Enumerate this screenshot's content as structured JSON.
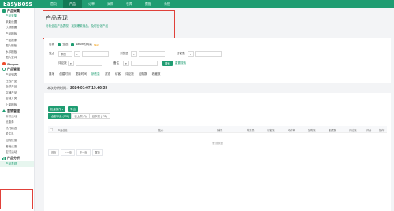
{
  "app": {
    "logo": "EasyBoss"
  },
  "topnav": [
    "首页",
    "产品",
    "订单",
    "采购",
    "仓库",
    "数据",
    "系统"
  ],
  "sidebar": {
    "sections": [
      {
        "label": "产品采集",
        "items": [
          "产品采集",
          "采集设置",
          "认领配置",
          "产品模板",
          "产品搬家",
          "图片模板",
          "水印模板",
          "图片空间"
        ]
      },
      {
        "label": "Shopee",
        "items": []
      },
      {
        "label": "产品管理",
        "items": [
          "产品列表",
          "在线产品",
          "全球产品",
          "店铺产品",
          "店铺分类",
          "上架模板"
        ]
      },
      {
        "label": "营销管理",
        "items": [
          "折扣活动",
          "优惠券",
          "热门精选",
          "关注礼",
          "加购优惠",
          "套装优惠",
          "定时活动"
        ]
      },
      {
        "label": "产品分析",
        "items": [
          "产品表现"
        ]
      }
    ]
  },
  "header": {
    "title": "产品表现",
    "desc": "分析全店产品表现，找到爆款商品，及时优化产品"
  },
  "filters": {
    "row1": {
      "shop_label": "店铺",
      "all_label": "全选",
      "site_label": "sarvib的网站",
      "badge": "NEW"
    },
    "row2": [
      {
        "label": "站点",
        "value": "泰国"
      },
      {
        "label": "浏览量",
        "value": ""
      },
      {
        "label": "访客数",
        "value": ""
      }
    ],
    "row3": [
      {
        "label": "评论数",
        "value": ""
      },
      {
        "label": "备注",
        "value": ""
      }
    ],
    "search_button": "搜索",
    "reset_link": "重置搜索",
    "sort_label": "排序",
    "sort_options": [
      "创建时间",
      "更新时间",
      "销售量",
      "浏览",
      "访客",
      "评论数",
      "加购数",
      "收藏数"
    ]
  },
  "stats": {
    "label": "本次分析时间：",
    "time": "2024-01-07 19:46:33"
  },
  "toolbar": {
    "button1": "批量操作",
    "button2": "导出"
  },
  "tabs": [
    "全部产品 (125)",
    "已上架 (0)",
    "已下架 (125)"
  ],
  "table": {
    "columns": [
      "产品信息",
      "售价",
      "销量",
      "浏览量",
      "访客数",
      "转化率",
      "加购数",
      "收藏数",
      "评论数",
      "评分",
      "操作"
    ],
    "empty_text": "暂无数据"
  },
  "pager": [
    "首页",
    "上一页",
    "下一页",
    "尾页"
  ]
}
